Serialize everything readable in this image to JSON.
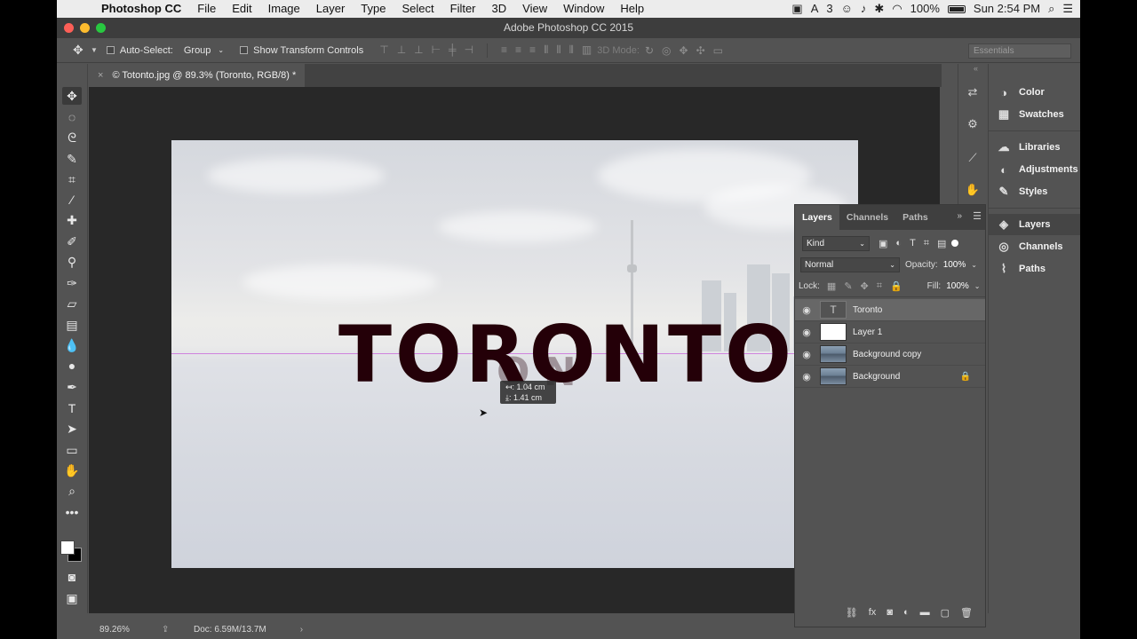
{
  "menubar": {
    "app_name": "Photoshop CC",
    "items": [
      "File",
      "Edit",
      "Image",
      "Layer",
      "Type",
      "Select",
      "Filter",
      "3D",
      "View",
      "Window",
      "Help"
    ],
    "status_number": "3",
    "battery": "100%",
    "clock": "Sun 2:54 PM"
  },
  "window": {
    "title": "Adobe Photoshop CC 2015"
  },
  "options_bar": {
    "auto_select_label": "Auto-Select:",
    "auto_select_value": "Group",
    "transform_controls_label": "Show Transform Controls",
    "mode_3d_label": "3D Mode:",
    "workspace": "Essentials"
  },
  "document": {
    "tab_title": "© Totonto.jpg @ 89.3% (Toronto, RGB/8) *",
    "canvas_text": "TORONTO",
    "ghost_text": "O N",
    "measure_x": "↤: 1.04 cm",
    "measure_y": "⤓: 1.41 cm"
  },
  "status_bar": {
    "zoom": "89.26%",
    "doc_size": "Doc: 6.59M/13.7M"
  },
  "right_panel": {
    "group1": [
      {
        "icon": "color-icon",
        "label": "Color"
      },
      {
        "icon": "swatches-icon",
        "label": "Swatches"
      }
    ],
    "group2": [
      {
        "icon": "libraries-icon",
        "label": "Libraries"
      },
      {
        "icon": "adjustments-icon",
        "label": "Adjustments"
      },
      {
        "icon": "styles-icon",
        "label": "Styles"
      }
    ],
    "group3": [
      {
        "icon": "layers-icon",
        "label": "Layers"
      },
      {
        "icon": "channels-icon",
        "label": "Channels"
      },
      {
        "icon": "paths-icon",
        "label": "Paths"
      }
    ]
  },
  "layers_panel": {
    "tabs": [
      "Layers",
      "Channels",
      "Paths"
    ],
    "filter_kind": "Kind",
    "blend_mode": "Normal",
    "opacity_label": "Opacity:",
    "opacity": "100%",
    "lock_label": "Lock:",
    "fill_label": "Fill:",
    "fill": "100%",
    "layers": [
      {
        "name": "Toronto",
        "type": "text",
        "selected": true,
        "locked": false
      },
      {
        "name": "Layer 1",
        "type": "white",
        "selected": false,
        "locked": false
      },
      {
        "name": "Background copy",
        "type": "photo",
        "selected": false,
        "locked": false
      },
      {
        "name": "Background",
        "type": "photo",
        "selected": false,
        "locked": true
      }
    ]
  },
  "colors": {
    "text_color": "#240008",
    "guide_color": "#c96ad9",
    "ui_panel": "#535353"
  }
}
